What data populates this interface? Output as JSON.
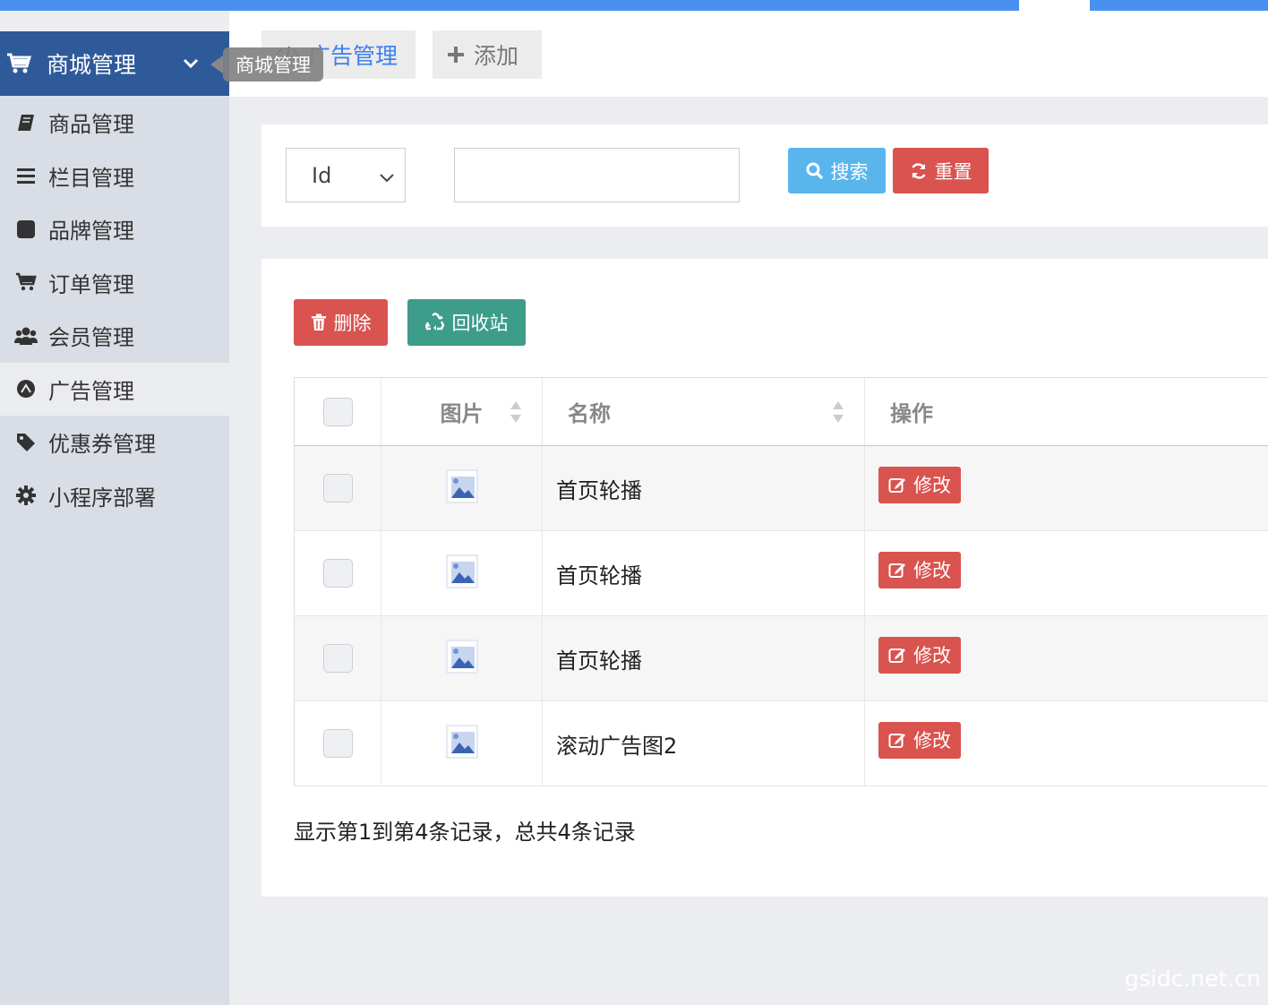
{
  "sidebar": {
    "header_label": "商城管理",
    "tooltip": "商城管理",
    "items": [
      {
        "label": "商品管理",
        "icon": "book-icon"
      },
      {
        "label": "栏目管理",
        "icon": "bars-icon"
      },
      {
        "label": "品牌管理",
        "icon": "square-icon"
      },
      {
        "label": "订单管理",
        "icon": "cart-icon"
      },
      {
        "label": "会员管理",
        "icon": "users-icon"
      },
      {
        "label": "广告管理",
        "icon": "ad-icon",
        "active": true
      },
      {
        "label": "优惠券管理",
        "icon": "tag-icon"
      },
      {
        "label": "小程序部署",
        "icon": "gear-icon"
      }
    ]
  },
  "tabs": [
    {
      "label": "广告管理",
      "icon": "code-icon",
      "active": true
    },
    {
      "label": "添加",
      "icon": "plus-icon"
    }
  ],
  "search": {
    "field_selected": "Id",
    "input_value": "",
    "search_label": "搜索",
    "reset_label": "重置"
  },
  "toolbar": {
    "delete_label": "删除",
    "recycle_label": "回收站"
  },
  "table": {
    "columns": {
      "image": "图片",
      "name": "名称",
      "action": "操作"
    },
    "rows": [
      {
        "name": "首页轮播",
        "action": "修改"
      },
      {
        "name": "首页轮播",
        "action": "修改"
      },
      {
        "name": "首页轮播",
        "action": "修改"
      },
      {
        "name": "滚动广告图2",
        "action": "修改"
      }
    ]
  },
  "pagination": {
    "summary": "显示第1到第4条记录，总共4条记录"
  },
  "watermark": "gsidc.net.cn",
  "colors": {
    "top_bar": "#4a90f0",
    "sidebar_header": "#2f5a9a",
    "primary_tab": "#3d7ff0",
    "search_btn": "#5ab5ed",
    "danger": "#d9534f",
    "recycle_btn": "#3d9c8a"
  }
}
